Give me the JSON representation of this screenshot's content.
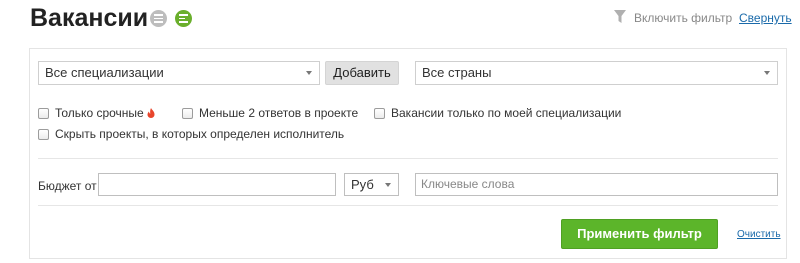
{
  "header": {
    "title": "Вакансии",
    "view_icons": [
      "list-view-icon",
      "text-view-icon"
    ],
    "filter_toggle_label": "Включить фильтр",
    "collapse_label": "Свернуть"
  },
  "filters": {
    "specialization_select": {
      "selected": "Все специализации"
    },
    "add_button_label": "Добавить",
    "country_select": {
      "selected": "Все страны"
    },
    "checkboxes": [
      {
        "label": "Только срочные",
        "checked": false,
        "icon": "fire-icon"
      },
      {
        "label": "Меньше 2 ответов в проекте",
        "checked": false
      },
      {
        "label": "Вакансии только по моей специализации",
        "checked": false
      },
      {
        "label": "Скрыть проекты, в которых определен исполнитель",
        "checked": false
      }
    ],
    "budget": {
      "label": "Бюджет от",
      "value": "",
      "currency_selected": "Руб"
    },
    "keywords": {
      "value": "",
      "placeholder": "Ключевые слова"
    },
    "apply_button_label": "Применить фильтр",
    "clear_label": "Очистить"
  },
  "colors": {
    "accent_green": "#5cb52a",
    "link_blue": "#1a6aaa",
    "fire_red": "#e8452c"
  }
}
